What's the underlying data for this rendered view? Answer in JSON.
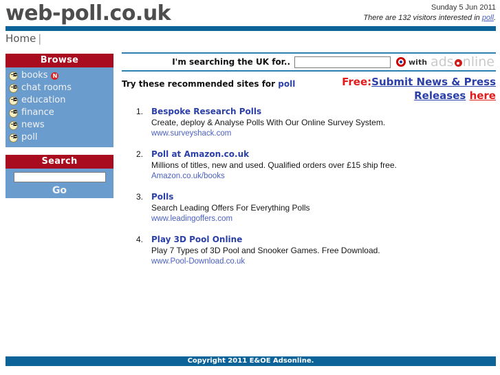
{
  "header": {
    "site_title": "web-poll.co.uk",
    "date": "Sunday 5 Jun 2011",
    "visitors_prefix": "There are 132 visitors interested in ",
    "visitors_keyword": "poll",
    "visitors_suffix": ".",
    "rule_color": "#0b6398"
  },
  "nav": {
    "home_label": "Home",
    "separator": "|"
  },
  "sidebar": {
    "browse": {
      "title": "Browse",
      "items": [
        {
          "label": "books",
          "badge": "N"
        },
        {
          "label": "chat rooms",
          "badge": ""
        },
        {
          "label": "education",
          "badge": ""
        },
        {
          "label": "finance",
          "badge": ""
        },
        {
          "label": "news",
          "badge": ""
        },
        {
          "label": "poll",
          "badge": ""
        }
      ]
    },
    "search": {
      "title": "Search",
      "input_value": "",
      "input_placeholder": "",
      "go_label": "Go"
    },
    "header_color": "#a80c1e",
    "body_color": "#6a9cce"
  },
  "main": {
    "searchbar": {
      "label": "I'm searching the UK for..",
      "input_value": "",
      "input_placeholder": "",
      "with_text": "with",
      "brand_part1": "ads",
      "brand_part2": "nline"
    },
    "try_prefix": "Try these recommended sites for ",
    "try_keyword": "poll",
    "promo": {
      "free_label": "Free:",
      "link_text": "Submit News & Press Releases",
      "here_label": "here"
    },
    "results": [
      {
        "num": "1.",
        "title": "Bespoke Research Polls",
        "desc": "Create, deploy & Analyse Polls With Our Online Survey System.",
        "url": "www.surveyshack.com"
      },
      {
        "num": "2.",
        "title": "Poll at Amazon.co.uk",
        "desc": "Millions of titles, new and used. Qualified orders over £15 ship free.",
        "url": "Amazon.co.uk/books"
      },
      {
        "num": "3.",
        "title": "Polls",
        "desc": "Search Leading Offers For Everything Polls",
        "url": "www.leadingoffers.com"
      },
      {
        "num": "4.",
        "title": "Play 3D Pool Online",
        "desc": "Play 7 Types of 3D Pool and Snooker Games. Free Download.",
        "url": "www.Pool-Download.co.uk"
      }
    ]
  },
  "footer": {
    "copyright": "Copyright 2011 E&OE Adsonline.",
    "background": "#0b6398"
  }
}
